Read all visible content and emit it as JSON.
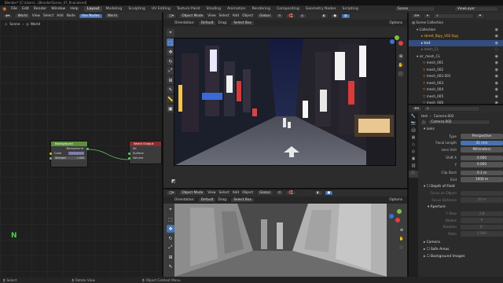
{
  "titlebar": {
    "text": "Blender* [C:\\Users\\...\\Blender\\Scene_07_final.blend]"
  },
  "menu": [
    "File",
    "Edit",
    "Render",
    "Window",
    "Help"
  ],
  "workspaces": [
    "Layout",
    "Modeling",
    "Sculpting",
    "UV Editing",
    "Texture Paint",
    "Shading",
    "Animation",
    "Rendering",
    "Compositing",
    "Geometry Nodes",
    "Scripting"
  ],
  "active_workspace": "Layout",
  "scene_field": "Scene",
  "viewlayer_field": "ViewLayer",
  "node_editor": {
    "editor_type": "World",
    "menu": [
      "View",
      "Select",
      "Add",
      "Node"
    ],
    "use_nodes": "Use Nodes",
    "slot": "World",
    "breadcrumb_scene": "Scene",
    "breadcrumb_world": "World",
    "n_key": "N"
  },
  "bg_node": {
    "title": "Background",
    "out": "Background",
    "color": "Color",
    "strength_label": "Strength",
    "strength_value": "1.000"
  },
  "out_node": {
    "title": "World Output",
    "target": "All",
    "surface": "Surface",
    "volume": "Volume"
  },
  "viewport_top": {
    "mode": "Object Mode",
    "menu": [
      "View",
      "Select",
      "Add",
      "Object"
    ],
    "orientation_label": "Orientation:",
    "orientation": "Default",
    "drag_label": "Drag:",
    "drag": "Select Box",
    "transform": "Global",
    "options": "Options"
  },
  "viewport_bottom": {
    "mode": "Object Mode",
    "menu": [
      "View",
      "Select",
      "Add",
      "Object"
    ],
    "orientation_label": "Orientation:",
    "orientation": "Default",
    "drag_label": "Drag:",
    "drag": "Select Box",
    "transform": "Global",
    "options": "Options"
  },
  "outliner": {
    "header": "Scene",
    "items": [
      {
        "label": "Scene Collection"
      },
      {
        "label": "Collection"
      },
      {
        "label": "street_fbpy_V02.fspy"
      },
      {
        "label": "test"
      },
      {
        "label": "mesh_CL"
      },
      {
        "label": "nir_mesh_CL"
      },
      {
        "label": "mesh_001"
      },
      {
        "label": "mesh_002"
      },
      {
        "label": "mesh_002.001"
      },
      {
        "label": "mesh_003"
      },
      {
        "label": "mesh_004"
      },
      {
        "label": "mesh_005"
      },
      {
        "label": "mesh_006"
      },
      {
        "label": "mesh_007"
      }
    ]
  },
  "properties": {
    "breadcrumb_object": "test",
    "breadcrumb_data": "Camera.002",
    "data_name": "Camera.002",
    "lens_section": "Lens",
    "type_label": "Type",
    "type_value": "Perspective",
    "focal_label": "Focal Length",
    "focal_value": "41 mm",
    "unit_label": "Lens Unit",
    "unit_value": "Millimeters",
    "shiftx_label": "Shift X",
    "shiftx_value": "0.000",
    "shifty_label": "Y",
    "shifty_value": "0.000",
    "clipstart_label": "Clip Start",
    "clipstart_value": "0.1 m",
    "end_label": "End",
    "end_value": "1000 m",
    "dof_section": "Depth of Field",
    "focus_obj_label": "Focus on Object",
    "focus_dist_label": "Focus Distance",
    "focus_dist_value": "10 m",
    "aperture_section": "Aperture",
    "fstop_label": "F-Stop",
    "fstop_value": "2.8",
    "blades_label": "Blades",
    "blades_value": "0",
    "rotation_label": "Rotation",
    "rotation_value": "0°",
    "ratio_label": "Ratio",
    "ratio_value": "1.000",
    "camera_section": "Camera",
    "safe_section": "Safe Areas",
    "bgimg_section": "Background Images"
  },
  "statusbar": {
    "select": "Select",
    "rotate": "Rotate View",
    "context": "Object Context Menu"
  },
  "colors": {
    "accent": "#4772b3",
    "selected_orange": "#ffaf29",
    "node_bg_header": "#5c8f3a",
    "node_out_header": "#8a2d2d"
  }
}
